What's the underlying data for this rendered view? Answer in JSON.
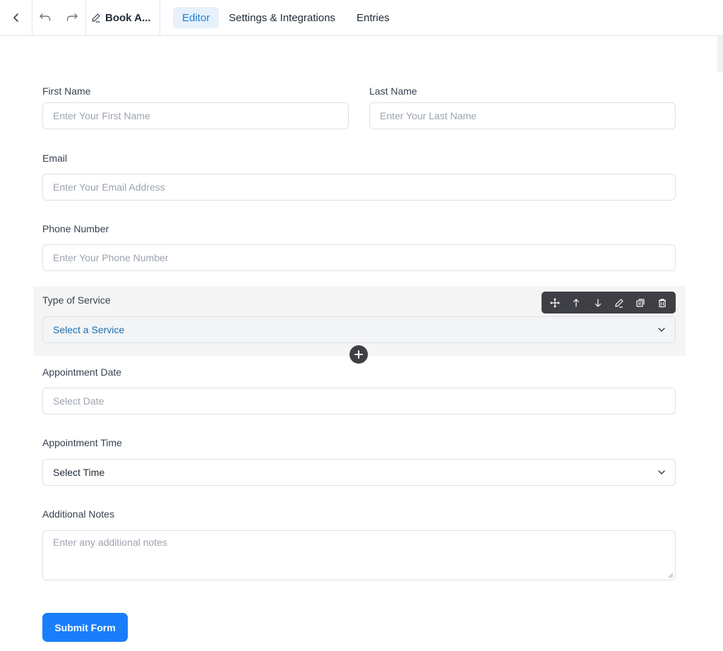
{
  "header": {
    "form_title": "Book A...",
    "tabs": [
      {
        "label": "Editor",
        "active": true
      },
      {
        "label": "Settings & Integrations",
        "active": false
      },
      {
        "label": "Entries",
        "active": false
      }
    ],
    "icons": [
      "back-icon",
      "undo-icon",
      "redo-icon",
      "pencil-icon"
    ]
  },
  "form": {
    "first_name": {
      "label": "First Name",
      "placeholder": "Enter Your First Name"
    },
    "last_name": {
      "label": "Last Name",
      "placeholder": "Enter Your Last Name"
    },
    "email": {
      "label": "Email",
      "placeholder": "Enter Your Email Address"
    },
    "phone": {
      "label": "Phone Number",
      "placeholder": "Enter Your Phone Number"
    },
    "service": {
      "label": "Type of Service",
      "selected": "Select a Service"
    },
    "date": {
      "label": "Appointment Date",
      "placeholder": "Select Date"
    },
    "time": {
      "label": "Appointment Time",
      "selected": "Select Time"
    },
    "notes": {
      "label": "Additional Notes",
      "placeholder": "Enter any additional notes"
    },
    "submit_label": "Submit Form"
  },
  "field_toolbar": {
    "icons": [
      "move-icon",
      "arrow-up-icon",
      "arrow-down-icon",
      "edit-icon",
      "duplicate-icon",
      "trash-icon"
    ]
  },
  "colors": {
    "accent": "#1a7efb",
    "active_tab_bg": "#e6f1fb",
    "active_tab_text": "#1c7ed6",
    "toolbar_bg": "#3f3f46",
    "highlight_bg": "#f5f5f5",
    "selected_service_text": "#1c6fb0"
  }
}
